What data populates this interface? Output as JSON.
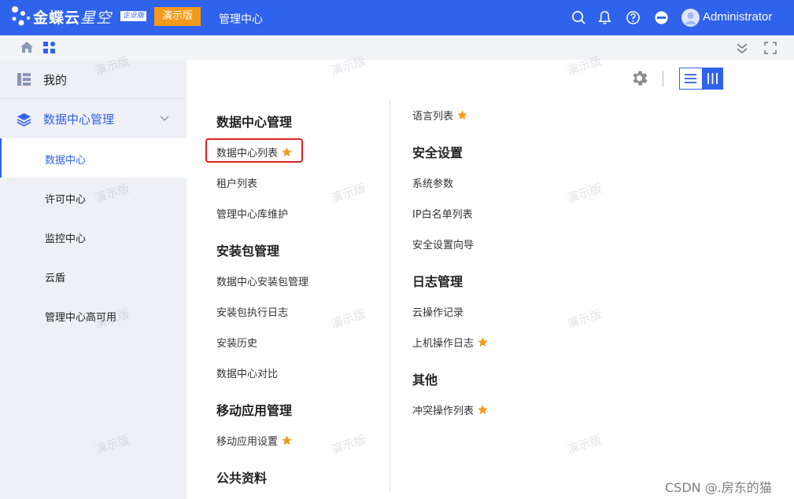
{
  "topbar": {
    "brand_bold": "金蝶云",
    "brand_light": "星空",
    "edition_badge": "企业版",
    "demo_badge": "演示版",
    "title": "管理中心",
    "user_name": "Administrator",
    "bg_color": "#2f63ec"
  },
  "sidebar": {
    "top_item": "我的",
    "section_label": "数据中心管理",
    "items": [
      {
        "label": "数据中心",
        "active": true
      },
      {
        "label": "许可中心",
        "active": false
      },
      {
        "label": "监控中心",
        "active": false
      },
      {
        "label": "云盾",
        "active": false
      },
      {
        "label": "管理中心高可用",
        "active": false
      }
    ]
  },
  "menu": {
    "col1": {
      "g1_title": "数据中心管理",
      "g1_links": [
        "数据中心列表",
        "租户列表",
        "管理中心库维护"
      ],
      "g2_title": "安装包管理",
      "g2_links": [
        "数据中心安装包管理",
        "安装包执行日志",
        "安装历史",
        "数据中心对比"
      ],
      "g3_title": "移动应用管理",
      "g3_links": [
        "移动应用设置"
      ],
      "g4_title": "公共资料"
    },
    "col2": {
      "top_link": "语言列表",
      "g1_title": "安全设置",
      "g1_links": [
        "系统参数",
        "IP白名单列表",
        "安全设置向导"
      ],
      "g2_title": "日志管理",
      "g2_links": [
        "云操作记录",
        "上机操作日志"
      ],
      "g3_title": "其他",
      "g3_links": [
        "冲突操作列表"
      ]
    }
  },
  "watermark_text": "演示版",
  "corner_text": "CSDN @.房东的猫",
  "colors": {
    "accent": "#2f63ec",
    "star": "#f39a1b",
    "highlight": "#e02020"
  }
}
